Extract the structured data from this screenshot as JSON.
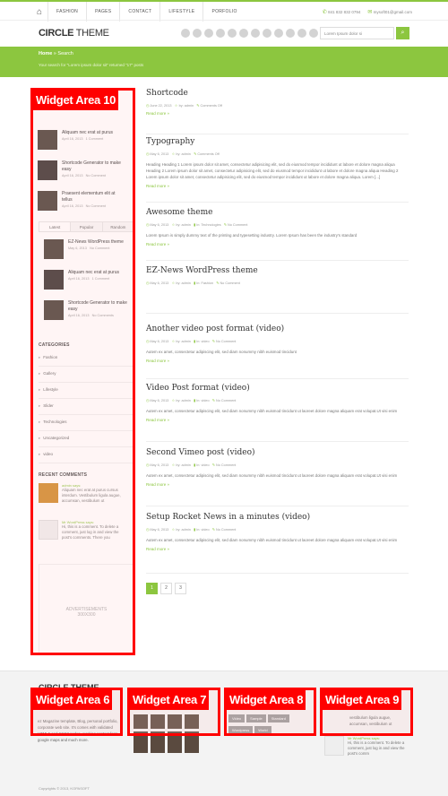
{
  "topnav": {
    "items": [
      "FASHION",
      "PAGES",
      "CONTACT",
      "LIFESTYLE",
      "PORFOLIO"
    ],
    "phone": "841 832 832 0794",
    "email": "mysoft01@gmail.com"
  },
  "header": {
    "logo_bold": "CIRCLE",
    "logo_light": " THEME",
    "search_placeholder": "Lorem Ipsum dolor si"
  },
  "greenbar": {
    "home": "Home",
    "sep": " » ",
    "current": "Search",
    "info": "Your search for \"Lorem ipsum dolor sit\" returned \"17\" posts"
  },
  "sidebar": {
    "posts_top": [
      {
        "title": "Aliquam nec erat at purus",
        "date": "April 16, 2013",
        "comments": "1 Comment"
      },
      {
        "title": "Shortcode Generator to make easy",
        "date": "April 16, 2013",
        "comments": "No Comment"
      },
      {
        "title": "Praesent elementum elit at tellus",
        "date": "April 16, 2013",
        "comments": "No Comment"
      }
    ],
    "tabs": [
      "Latest",
      "Popular",
      "Random"
    ],
    "tab_posts": [
      {
        "title": "EZ-News WordPress theme",
        "date": "May 6, 2013",
        "comments": "No Comment"
      },
      {
        "title": "Aliquam nec erat at purus",
        "date": "April 16, 2013",
        "comments": "1 Comment"
      },
      {
        "title": "Shortcode Generator to make easy",
        "date": "April 16, 2013",
        "comments": "No Comments"
      }
    ],
    "categories_head": "CATEGORIES",
    "categories": [
      "Fashion",
      "Gallery",
      "Lifestyle",
      "Slider",
      "Technologies",
      "Uncategorized",
      "video"
    ],
    "recent_head": "RECENT COMMENTS",
    "comments": [
      {
        "author": "admin says:",
        "text": "Aliquam nec erat at purus cursus interdum. Vestibulum ligula augue, accumsan, vestibulum ut"
      },
      {
        "author": "Mr WordPress says:",
        "text": "Hi, this is a comment. To delete a comment, just log in and view the post's comments. There you"
      }
    ],
    "ad_text": "ADVERTISEMENTS\n300X300"
  },
  "posts": [
    {
      "title": "Shortcode",
      "date": "June 22, 2013",
      "author": "by: admin",
      "cat": "",
      "comments": "Comments Off",
      "excerpt": "",
      "more": "Read more »"
    },
    {
      "title": "Typography",
      "date": "May 6, 2013",
      "author": "by: admin",
      "cat": "",
      "comments": "Comments Off",
      "excerpt": "Heading Heading 1 Lorem ipsum dolor sit amet, consectetur adipisicing elit, sed do eiusmod tempor incididunt ut labore et dolore magna aliqua Heading 2 Lorem ipsum dolor sit amet, consectetur adipisicing elit, sed do eiusmod tempor incididunt ut labore et dolore magna aliqua Heading 2 Lorem ipsum dolor sit amet, consectetur adipisicing elit, sed do eiusmod tempor incididunt ut labore et dolore magna aliqua. Lorem [...]",
      "more": "Read more »"
    },
    {
      "title": "Awesome theme",
      "date": "May 6, 2013",
      "author": "by: admin",
      "cat": "In: Technologies",
      "comments": "No Comment",
      "excerpt": "Lorem Ipsum is simply dummy text of the printing and typesetting industry. Lorem Ipsum has been the industry's standard",
      "more": "Read more »"
    },
    {
      "title": "EZ-News WordPress theme",
      "date": "May 6, 2013",
      "author": "by: admin",
      "cat": "In: Fashion",
      "comments": "No Comment",
      "excerpt": "",
      "more": ""
    },
    {
      "title": "Another video post format (video)",
      "date": "May 6, 2013",
      "author": "by: admin",
      "cat": "In: video",
      "comments": "No Comment",
      "excerpt": "Autem ex amet, consectetur adipiscing elit, sed diam nonummy nibh euismod tincidunt",
      "more": "Read more »"
    },
    {
      "title": "Video Post format (video)",
      "date": "May 6, 2013",
      "author": "by: admin",
      "cat": "In: video",
      "comments": "No Comment",
      "excerpt": "Autem ex amet, consectetur adipiscing elit, sed diam nonummy nibh euismod tincidunt ut laoreet dolore magna aliquam erat volupat.Ut visi enim",
      "more": "Read more »"
    },
    {
      "title": "Second Vimeo post (video)",
      "date": "May 6, 2013",
      "author": "by: admin",
      "cat": "In: video",
      "comments": "No Comment",
      "excerpt": "Autem ex amet, consectetur adipiscing elit, sed diam nonummy nibh euismod tincidunt ut laoreet dolore magna aliquam erat volupat.Ut visi enim",
      "more": "Read more »"
    },
    {
      "title": "Setup Rocket News in a minutes (video)",
      "date": "May 6, 2013",
      "author": "by: admin",
      "cat": "In: video",
      "comments": "No Comment",
      "excerpt": "Autem ex amet, consectetur adipiscing elit, sed diam nonummy nibh euismod tincidunt ut laoreet dolore magna aliquam erat volupat.Ut visi enim",
      "more": "Read more »"
    }
  ],
  "pager": [
    "1",
    "2",
    "3"
  ],
  "overlays": [
    "Widget Area 10",
    "Widget Area 6",
    "Widget Area 7",
    "Widget Area 8",
    "Widget Area 9"
  ],
  "footer": {
    "title": "CIRCLE THEME",
    "about": "ez Magazine template, Blog, personal portfolio, corporate web site. It's comes with validated HTML5 and CSS3 codes, working contact form, google maps and much more.",
    "tags": [
      "Video",
      "Sample",
      "Standard",
      "Wordpress",
      "World"
    ],
    "comment_author": "Mr WordPress says:",
    "comment_text": "Hi, this is a comment. To delete a comment, just log in and view the post's comm",
    "comment_top": "vestibulum ligula augue, accumsan, vestibulum ut",
    "copyright": "Copyrights © 2013, KOPASOFT"
  },
  "colors": {
    "accent": "#8cc63f",
    "overlay": "#ff0000"
  }
}
